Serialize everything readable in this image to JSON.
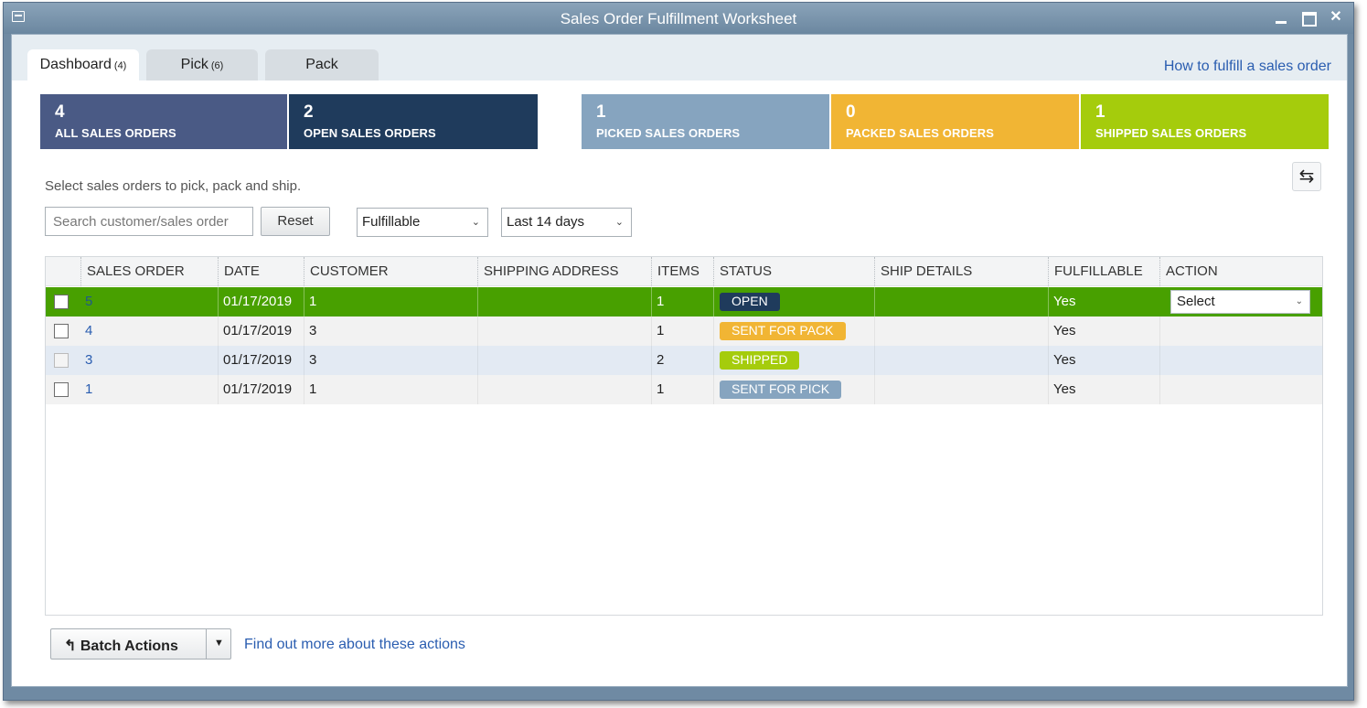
{
  "window": {
    "title": "Sales Order Fulfillment Worksheet"
  },
  "tabs": [
    {
      "label": "Dashboard",
      "count": "(4)"
    },
    {
      "label": "Pick",
      "count": "(6)"
    },
    {
      "label": "Pack",
      "count": ""
    }
  ],
  "help_link": "How to fulfill a sales order",
  "summary_cards": [
    {
      "value": "4",
      "label": "ALL SALES ORDERS",
      "color": "#4a5a85"
    },
    {
      "value": "2",
      "label": "OPEN SALES ORDERS",
      "color": "#1f3b5c"
    },
    {
      "value": "1",
      "label": "PICKED SALES ORDERS",
      "color": "#86a4bf"
    },
    {
      "value": "0",
      "label": "PACKED SALES ORDERS",
      "color": "#f1b534"
    },
    {
      "value": "1",
      "label": "SHIPPED SALES ORDERS",
      "color": "#a5cc0c"
    }
  ],
  "instructions": "Select sales orders to pick, pack and ship.",
  "search": {
    "placeholder": "Search customer/sales order"
  },
  "reset_label": "Reset",
  "filter_select": "Fulfillable",
  "range_select": "Last 14 days",
  "table": {
    "columns": [
      "SALES ORDER",
      "DATE",
      "CUSTOMER",
      "SHIPPING ADDRESS",
      "ITEMS",
      "STATUS",
      "SHIP DETAILS",
      "FULFILLABLE",
      "ACTION"
    ],
    "rows": [
      {
        "sales_order": "5",
        "date": "01/17/2019",
        "customer": "1",
        "shipping_address": "",
        "items": "1",
        "status": "OPEN",
        "status_color": "#1f3b5c",
        "ship_details": "",
        "fulfillable": "Yes",
        "action": "Select"
      },
      {
        "sales_order": "4",
        "date": "01/17/2019",
        "customer": "3",
        "shipping_address": "",
        "items": "1",
        "status": "SENT FOR PACK",
        "status_color": "#f1b534",
        "ship_details": "",
        "fulfillable": "Yes",
        "action": ""
      },
      {
        "sales_order": "3",
        "date": "01/17/2019",
        "customer": "3",
        "shipping_address": "",
        "items": "2",
        "status": "SHIPPED",
        "status_color": "#a5cc0c",
        "ship_details": "",
        "fulfillable": "Yes",
        "action": ""
      },
      {
        "sales_order": "1",
        "date": "01/17/2019",
        "customer": "1",
        "shipping_address": "",
        "items": "1",
        "status": "SENT FOR PICK",
        "status_color": "#86a4bf",
        "ship_details": "",
        "fulfillable": "Yes",
        "action": ""
      }
    ]
  },
  "batch_actions_label": "Batch Actions",
  "find_out_link": "Find out more about these actions"
}
